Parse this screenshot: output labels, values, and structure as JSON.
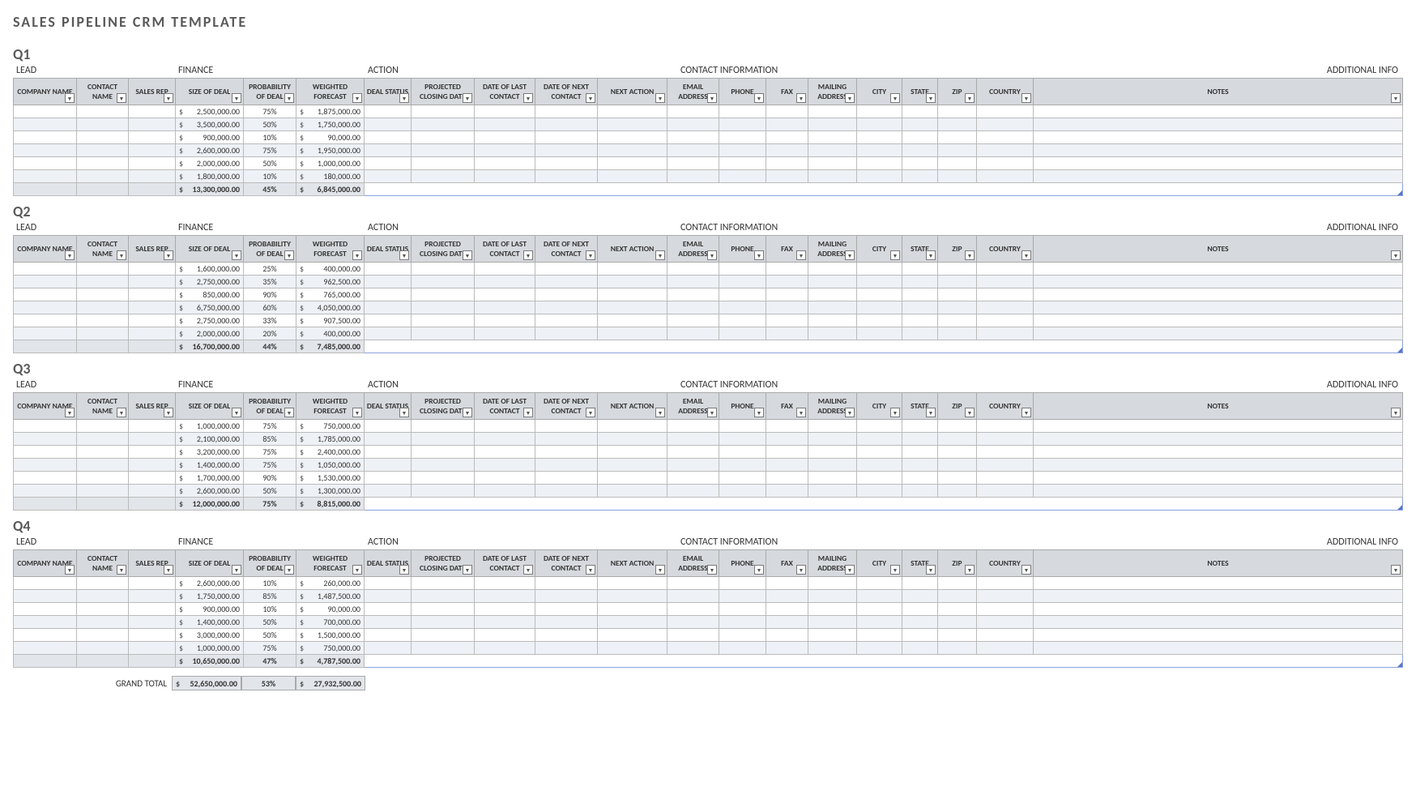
{
  "title": "SALES PIPELINE CRM TEMPLATE",
  "section_labels": {
    "lead": "LEAD",
    "finance": "FINANCE",
    "action": "ACTION",
    "contact": "CONTACT INFORMATION",
    "additional": "ADDITIONAL INFO"
  },
  "columns": [
    "COMPANY NAME",
    "CONTACT NAME",
    "SALES REP",
    "SIZE OF DEAL",
    "PROBABILITY OF DEAL",
    "WEIGHTED FORECAST",
    "DEAL STATUS",
    "PROJECTED CLOSING DATE",
    "DATE OF LAST CONTACT",
    "DATE OF NEXT CONTACT",
    "NEXT ACTION",
    "EMAIL ADDRESS",
    "PHONE",
    "FAX",
    "MAILING ADDRESS",
    "CITY",
    "STATE",
    "ZIP",
    "COUNTRY",
    "NOTES"
  ],
  "currency_symbol": "$",
  "quarters": [
    {
      "name": "Q1",
      "rows": [
        {
          "size": "2,500,000.00",
          "prob": "75%",
          "forecast": "1,875,000.00"
        },
        {
          "size": "3,500,000.00",
          "prob": "50%",
          "forecast": "1,750,000.00"
        },
        {
          "size": "900,000.00",
          "prob": "10%",
          "forecast": "90,000.00"
        },
        {
          "size": "2,600,000.00",
          "prob": "75%",
          "forecast": "1,950,000.00"
        },
        {
          "size": "2,000,000.00",
          "prob": "50%",
          "forecast": "1,000,000.00"
        },
        {
          "size": "1,800,000.00",
          "prob": "10%",
          "forecast": "180,000.00"
        }
      ],
      "subtotal": {
        "size": "13,300,000.00",
        "prob": "45%",
        "forecast": "6,845,000.00"
      }
    },
    {
      "name": "Q2",
      "rows": [
        {
          "size": "1,600,000.00",
          "prob": "25%",
          "forecast": "400,000.00"
        },
        {
          "size": "2,750,000.00",
          "prob": "35%",
          "forecast": "962,500.00"
        },
        {
          "size": "850,000.00",
          "prob": "90%",
          "forecast": "765,000.00"
        },
        {
          "size": "6,750,000.00",
          "prob": "60%",
          "forecast": "4,050,000.00"
        },
        {
          "size": "2,750,000.00",
          "prob": "33%",
          "forecast": "907,500.00"
        },
        {
          "size": "2,000,000.00",
          "prob": "20%",
          "forecast": "400,000.00"
        }
      ],
      "subtotal": {
        "size": "16,700,000.00",
        "prob": "44%",
        "forecast": "7,485,000.00"
      }
    },
    {
      "name": "Q3",
      "rows": [
        {
          "size": "1,000,000.00",
          "prob": "75%",
          "forecast": "750,000.00"
        },
        {
          "size": "2,100,000.00",
          "prob": "85%",
          "forecast": "1,785,000.00"
        },
        {
          "size": "3,200,000.00",
          "prob": "75%",
          "forecast": "2,400,000.00"
        },
        {
          "size": "1,400,000.00",
          "prob": "75%",
          "forecast": "1,050,000.00"
        },
        {
          "size": "1,700,000.00",
          "prob": "90%",
          "forecast": "1,530,000.00"
        },
        {
          "size": "2,600,000.00",
          "prob": "50%",
          "forecast": "1,300,000.00"
        }
      ],
      "subtotal": {
        "size": "12,000,000.00",
        "prob": "75%",
        "forecast": "8,815,000.00"
      }
    },
    {
      "name": "Q4",
      "rows": [
        {
          "size": "2,600,000.00",
          "prob": "10%",
          "forecast": "260,000.00"
        },
        {
          "size": "1,750,000.00",
          "prob": "85%",
          "forecast": "1,487,500.00"
        },
        {
          "size": "900,000.00",
          "prob": "10%",
          "forecast": "90,000.00"
        },
        {
          "size": "1,400,000.00",
          "prob": "50%",
          "forecast": "700,000.00"
        },
        {
          "size": "3,000,000.00",
          "prob": "50%",
          "forecast": "1,500,000.00"
        },
        {
          "size": "1,000,000.00",
          "prob": "75%",
          "forecast": "750,000.00"
        }
      ],
      "subtotal": {
        "size": "10,650,000.00",
        "prob": "47%",
        "forecast": "4,787,500.00"
      }
    }
  ],
  "grand_total": {
    "label": "GRAND TOTAL",
    "size": "52,650,000.00",
    "prob": "53%",
    "forecast": "27,932,500.00"
  }
}
